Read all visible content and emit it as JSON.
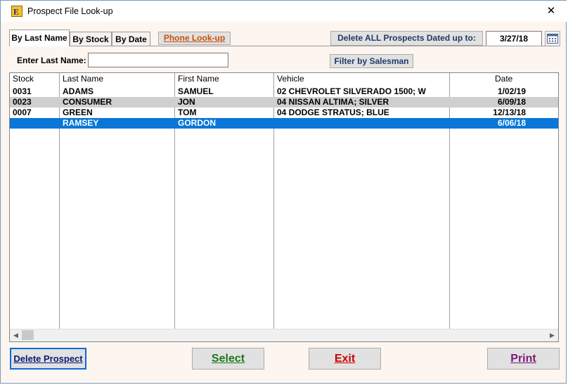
{
  "window": {
    "title": "Prospect File Look-up",
    "close_glyph": "✕",
    "icon": "prospect-app-icon"
  },
  "tabs": [
    {
      "label": "By Last Name",
      "active": true
    },
    {
      "label": "By Stock",
      "active": false
    },
    {
      "label": "By Date",
      "active": false
    }
  ],
  "toolbar": {
    "phone_lookup": "Phone Look-up",
    "delete_all": "Delete ALL Prospects Dated up to:",
    "date_value": "3/27/18",
    "calendar_icon": "calendar-icon",
    "filter_salesman": "Filter by Salesman"
  },
  "search": {
    "label": "Enter Last Name:",
    "value": ""
  },
  "table": {
    "columns": [
      "Stock",
      "Last Name",
      "First Name",
      "Vehicle",
      "Date"
    ],
    "rows": [
      {
        "stock": "0031",
        "last": "ADAMS",
        "first": "SAMUEL",
        "vehicle": "02 CHEVROLET SILVERADO 1500; W",
        "date": "1/02/19",
        "state": "normal"
      },
      {
        "stock": "0023",
        "last": "CONSUMER",
        "first": "JON",
        "vehicle": "04 NISSAN ALTIMA; SILVER",
        "date": "6/09/18",
        "state": "alternate"
      },
      {
        "stock": "0007",
        "last": "GREEN",
        "first": "TOM",
        "vehicle": "04 DODGE STRATUS; BLUE",
        "date": "12/13/18",
        "state": "normal"
      },
      {
        "stock": "",
        "last": "RAMSEY",
        "first": "GORDON",
        "vehicle": "",
        "date": "6/06/18",
        "state": "selected"
      }
    ]
  },
  "scrollbar": {
    "left_glyph": "◀",
    "right_glyph": "▶"
  },
  "buttons": {
    "delete_prospect": "Delete Prospect",
    "select": "Select",
    "exit": "Exit",
    "print": "Print"
  },
  "colors": {
    "selected_row": "#0a77d8",
    "alternate_row": "#cfcfcf",
    "select_text": "#1a7a1a",
    "exit_text": "#cc0000",
    "print_text": "#7a1a7a",
    "delete_text": "#0a1a70",
    "phone_text": "#c8500a"
  }
}
